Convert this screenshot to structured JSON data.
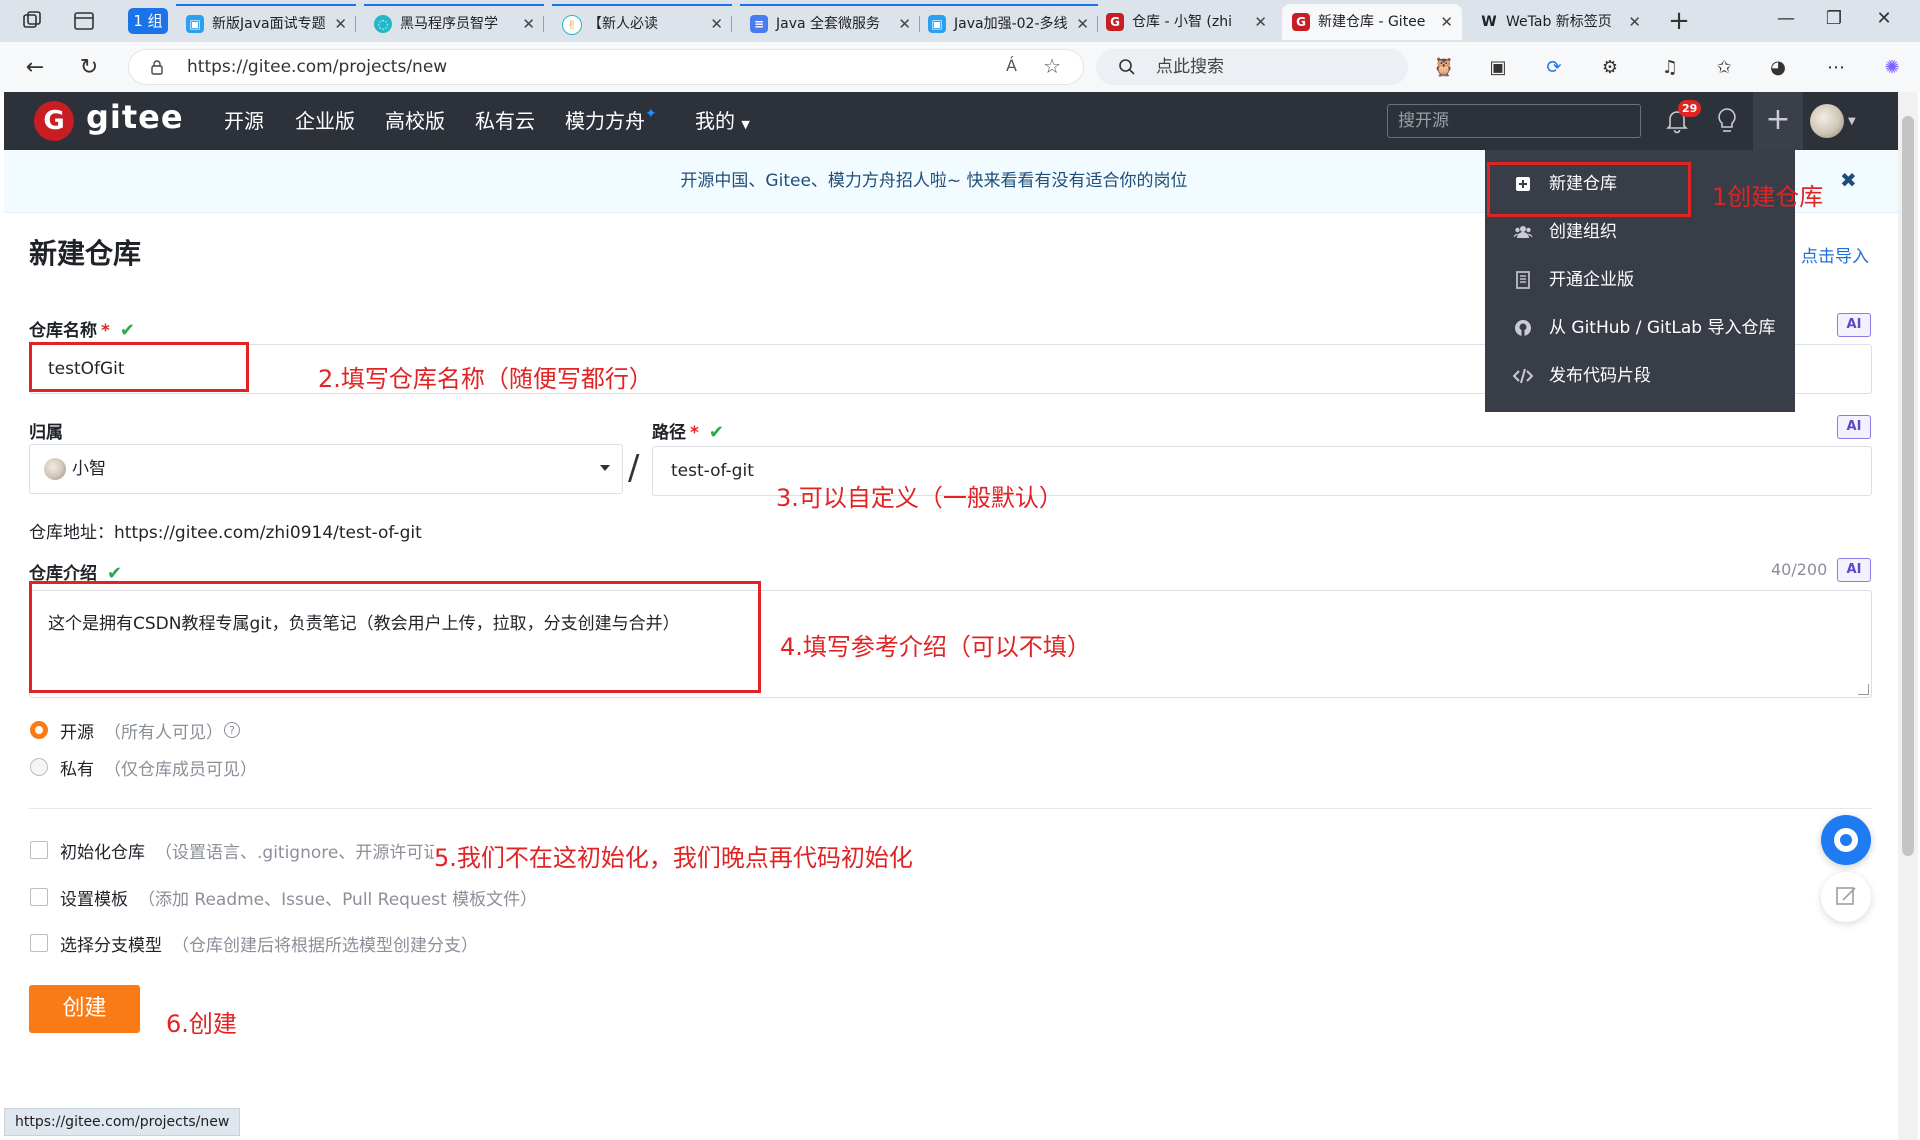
{
  "browser": {
    "group_label": "1 组",
    "tabs": [
      {
        "title": "新版Java面试专题",
        "favicon_color": "#2aa1f0"
      },
      {
        "title": "黑马程序员智学",
        "favicon_color": "#22b8c8"
      },
      {
        "title": "【新人必读",
        "favicon_color": "#e8a23b"
      },
      {
        "title": "Java 全套微服务",
        "favicon_color": "#4a7bf2"
      },
      {
        "title": "Java加强-02-多线",
        "favicon_color": "#2aa1f0"
      },
      {
        "title": "仓库 - 小智 (zhi",
        "favicon_color": "#c71d23"
      },
      {
        "title": "新建仓库 - Gitee",
        "favicon_color": "#c71d23"
      },
      {
        "title": "WeTab 新标签页",
        "favicon_color": "#1f2328"
      }
    ],
    "url": "https://gitee.com/projects/new",
    "search_placeholder": "点此搜索",
    "read_aloud_label": "Á"
  },
  "gitee": {
    "logo_letter": "G",
    "logo_text": "gitee",
    "nav": [
      "开源",
      "企业版",
      "高校版",
      "私有云",
      "模力方舟",
      "我的"
    ],
    "spark": "✦",
    "search_placeholder": "搜开源",
    "notif_count": "29",
    "plus": "+"
  },
  "announcement": "开源中国、Gitee、模力方舟招人啦~ 快来看看有没有适合你的岗位",
  "dropdown": {
    "items": [
      "新建仓库",
      "创建组织",
      "开通企业版",
      "从 GitHub / GitLab 导入仓库",
      "发布代码片段"
    ],
    "icons": [
      "plus-square-icon",
      "group-icon",
      "building-icon",
      "github-icon",
      "code-icon"
    ]
  },
  "form": {
    "title": "新建仓库",
    "import_link": "点击导入",
    "ai_tag": "AI",
    "name_label": "仓库名称",
    "name_value": "testOfGit",
    "owner_label": "归属",
    "owner_value": "小智",
    "path_label": "路径",
    "path_value": "test-of-git",
    "address": "仓库地址：https://gitee.com/zhi0914/test-of-git",
    "intro_label": "仓库介绍",
    "intro_value": "这个是拥有CSDN教程专属git，负责笔记（教会用户上传，拉取，分支创建与合并）",
    "intro_counter": "40/200",
    "visibility": [
      {
        "label": "开源",
        "hint": "（所有人可见）",
        "checked": true
      },
      {
        "label": "私有",
        "hint": "（仅仓库成员可见）",
        "checked": false
      }
    ],
    "options": [
      {
        "label": "初始化仓库",
        "hint": "（设置语言、.gitignore、开源许可证）"
      },
      {
        "label": "设置模板",
        "hint": "（添加 Readme、Issue、Pull Request 模板文件）"
      },
      {
        "label": "选择分支模型",
        "hint": "（仓库创建后将根据所选模型创建分支）"
      }
    ],
    "create_button": "创建"
  },
  "annotations": [
    "1创建仓库",
    "2.填写仓库名称（随便写都行）",
    "3.可以自定义（一般默认）",
    "4.填写参考介绍（可以不填）",
    "5.我们不在这初始化，我们晚点再代码初始化",
    "6.创建"
  ],
  "status_url": "https://gitee.com/projects/new",
  "colors": {
    "accent": "#fa7a16",
    "header": "#2d3139",
    "annotation": "#e02424",
    "link": "#1e6fd9"
  }
}
